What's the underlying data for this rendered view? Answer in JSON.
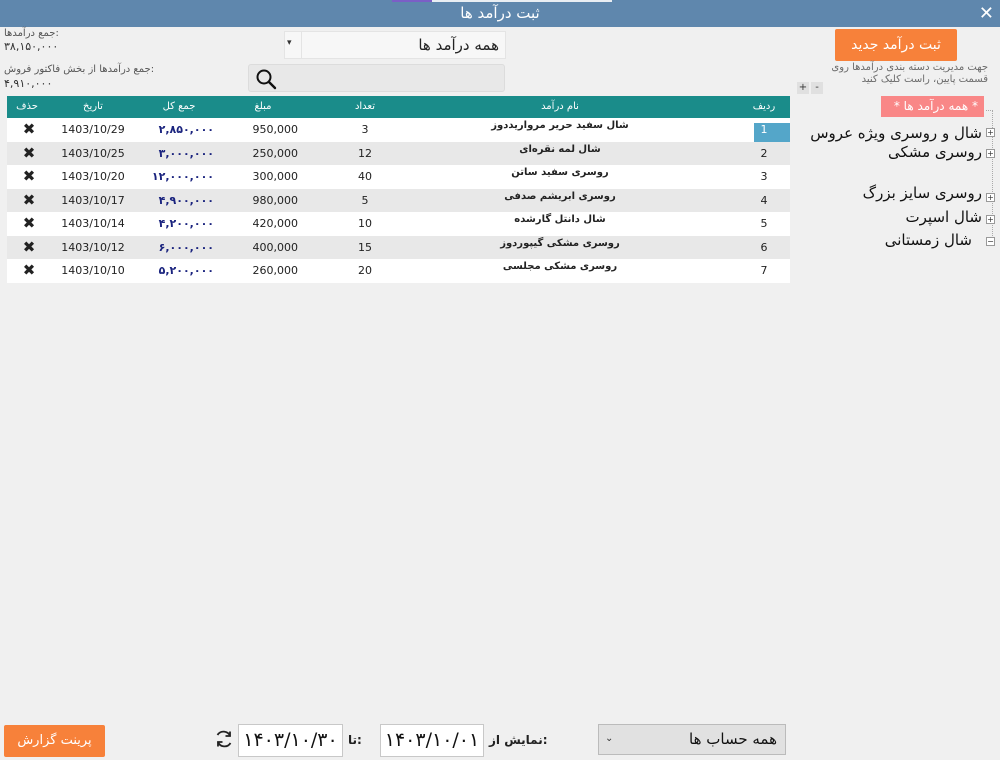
{
  "window": {
    "title": "ثبت درآمد ها",
    "close_icon": "close-icon"
  },
  "summary": {
    "income_total_label": "جمع درآمدها:",
    "income_total_value": "۳۸,۱۵۰,۰۰۰",
    "invoice_total_label": "جمع درآمدها از بخش فاکتور فروش:",
    "invoice_total_value": "۴,۹۱۰,۰۰۰"
  },
  "filter": {
    "category_dropdown_value": "همه درآمد ها",
    "search_icon": "search-icon"
  },
  "table": {
    "headers": {
      "row": "ردیف",
      "name": "نام درآمد",
      "count": "تعداد",
      "amount": "مبلغ",
      "total": "جمع کل",
      "date": "تاریخ",
      "delete": "حذف"
    },
    "rows": [
      {
        "row": "1",
        "name": "شال سفید حریر مرواریددوز",
        "count": "3",
        "amount": "950,000",
        "total": "۲,۸۵۰,۰۰۰",
        "date": "1403/10/29",
        "delete": "✖"
      },
      {
        "row": "2",
        "name": "شال لمه نقره‌ای",
        "count": "12",
        "amount": "250,000",
        "total": "۳,۰۰۰,۰۰۰",
        "date": "1403/10/25",
        "delete": "✖"
      },
      {
        "row": "3",
        "name": "روسری سفید ساتن",
        "count": "40",
        "amount": "300,000",
        "total": "۱۲,۰۰۰,۰۰۰",
        "date": "1403/10/20",
        "delete": "✖"
      },
      {
        "row": "4",
        "name": "روسری ابریشم صدفی",
        "count": "5",
        "amount": "980,000",
        "total": "۴,۹۰۰,۰۰۰",
        "date": "1403/10/17",
        "delete": "✖"
      },
      {
        "row": "5",
        "name": "شال دانتل گارشده",
        "count": "10",
        "amount": "420,000",
        "total": "۴,۲۰۰,۰۰۰",
        "date": "1403/10/14",
        "delete": "✖"
      },
      {
        "row": "6",
        "name": "روسری مشکی گیپوردوز",
        "count": "15",
        "amount": "400,000",
        "total": "۶,۰۰۰,۰۰۰",
        "date": "1403/10/12",
        "delete": "✖"
      },
      {
        "row": "7",
        "name": "روسری مشکی مجلسی",
        "count": "20",
        "amount": "260,000",
        "total": "۵,۲۰۰,۰۰۰",
        "date": "1403/10/10",
        "delete": "✖"
      }
    ]
  },
  "sidebar": {
    "new_button": "ثبت درآمد جدید",
    "hint_line1": "جهت مدیریت دسته بندی درآمدها روی",
    "hint_line2": "قسمت پایین، راست کلیک کنید",
    "expand_label": "+",
    "collapse_label": "-",
    "tree_root": "* همه درآمد ها *",
    "tree_items": [
      {
        "label": "شال و روسری ویژه عروس",
        "toggle": "+"
      },
      {
        "label": "روسری مشکی",
        "toggle": "+"
      },
      {
        "label": "روسری سایز بزرگ",
        "toggle": "+"
      },
      {
        "label": "شال اسپرت",
        "toggle": "+"
      },
      {
        "label": "شال زمستانی",
        "toggle": "−"
      }
    ]
  },
  "footer": {
    "account_dropdown_value": "همه حساب ها",
    "from_label": "نمایش از:",
    "from_date": "۱۴۰۳/۱۰/۰۱",
    "to_label": "تا:",
    "to_date": "۱۴۰۳/۱۰/۳۰",
    "refresh_icon": "refresh-icon",
    "print_button": "پرینت گزارش"
  },
  "colors": {
    "titlebar": "#5f87ad",
    "table_header": "#1a8c8a",
    "accent_button": "#f7813a",
    "tree_root": "#f98787",
    "selected_index": "#54a6c9",
    "total_text": "#1a237e"
  }
}
